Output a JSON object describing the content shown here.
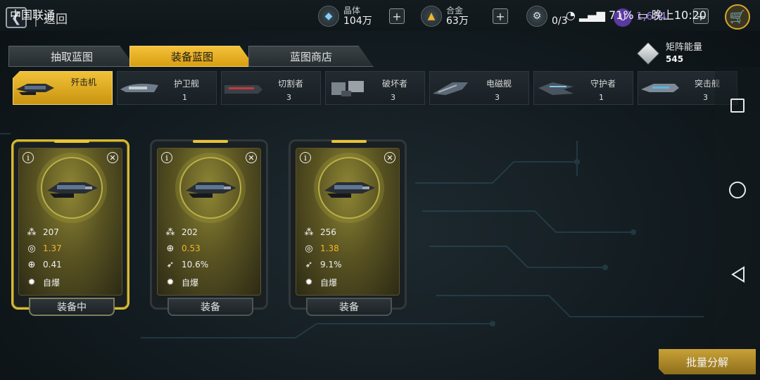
{
  "status_bar": {
    "carrier": "中国联通",
    "battery": "71%",
    "time": "晚上10:20"
  },
  "header": {
    "back_label": "返回",
    "crystal": {
      "label": "晶体",
      "value": "104万"
    },
    "alloy": {
      "label": "合金",
      "value": "63万"
    },
    "slots": {
      "value": "0/3"
    },
    "matrix_gem": {
      "value": "1,634"
    }
  },
  "tabs": [
    {
      "label": "抽取蓝图",
      "active": false
    },
    {
      "label": "装备蓝图",
      "active": true
    },
    {
      "label": "蓝图商店",
      "active": false
    }
  ],
  "energy": {
    "label": "矩阵能量",
    "value": "545"
  },
  "ship_types": [
    {
      "name": "歼击机",
      "count": "",
      "active": true
    },
    {
      "name": "护卫舰",
      "count": "1",
      "active": false
    },
    {
      "name": "切割者",
      "count": "3",
      "active": false
    },
    {
      "name": "破坏者",
      "count": "3",
      "active": false
    },
    {
      "name": "电磁舰",
      "count": "3",
      "active": false
    },
    {
      "name": "守护者",
      "count": "1",
      "active": false
    },
    {
      "name": "突击舰",
      "count": "3",
      "active": false
    }
  ],
  "cards": [
    {
      "hp": "207",
      "stat2": "1.37",
      "stat3": "0.41",
      "skill": "自爆",
      "button": "装备中",
      "selected": true
    },
    {
      "hp": "202",
      "stat2": "0.53",
      "stat3": "10.6%",
      "skill": "自爆",
      "button": "装备",
      "selected": false
    },
    {
      "hp": "256",
      "stat2": "1.38",
      "stat3": "9.1%",
      "skill": "自爆",
      "button": "装备",
      "selected": false
    }
  ],
  "bulk_button": {
    "label": "批量分解"
  },
  "colors": {
    "accent": "#f0b52a",
    "tab_active": "#e7b128",
    "matrix": "#9a79e0"
  }
}
